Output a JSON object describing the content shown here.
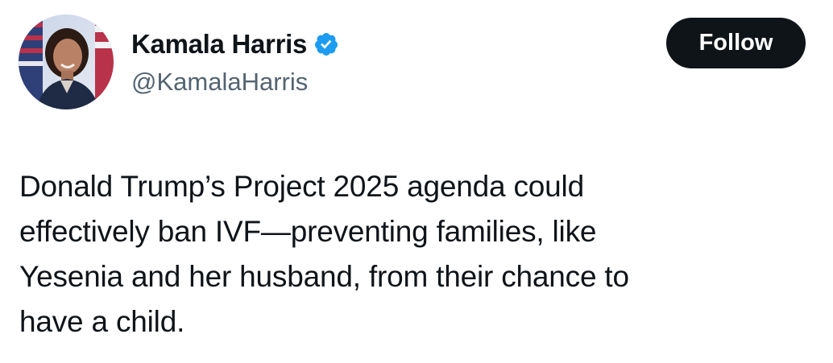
{
  "author": {
    "display_name": "Kamala Harris",
    "handle": "@KamalaHarris",
    "verified_icon": "verified-badge-icon",
    "verified_color": "#1d9bf0"
  },
  "follow_button": {
    "label": "Follow",
    "bg_color": "#0f1419",
    "text_color": "#ffffff"
  },
  "tweet": {
    "lines": [
      "Donald Trump’s Project 2025 agenda could",
      "effectively ban IVF—preventing families, like",
      "Yesenia and her husband, from their chance to",
      "have a child."
    ]
  }
}
